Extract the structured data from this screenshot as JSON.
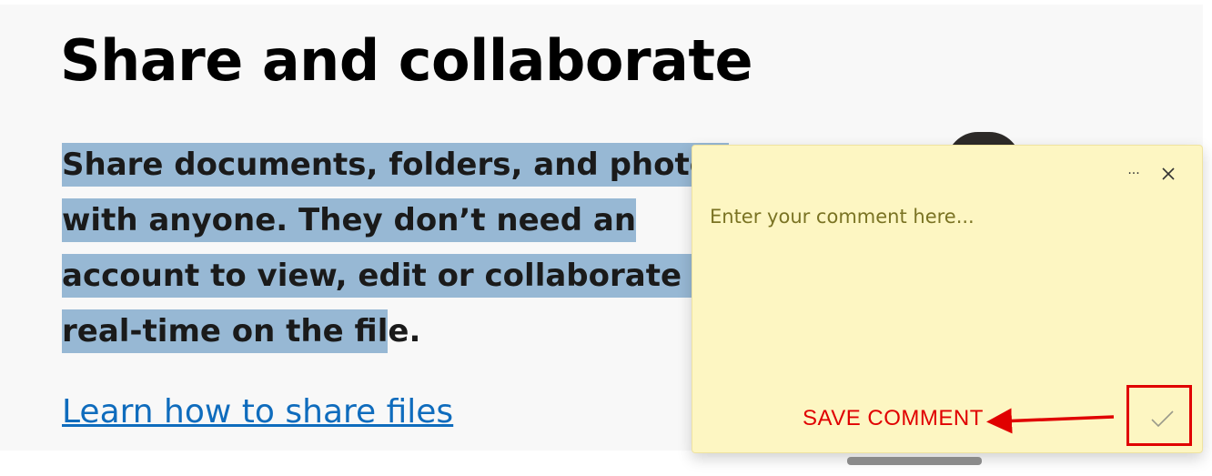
{
  "page": {
    "title": "Share and collaborate",
    "paragraph_lines": [
      "Share documents, folders, and photos",
      "with anyone. They don’t need an",
      "account to view, edit or collaborate in",
      "real-time on the fil"
    ],
    "paragraph_tail": "e.",
    "link_text": "Learn how to share files"
  },
  "comment_panel": {
    "more_icon": "ellipsis-icon",
    "more_label": "···",
    "close_icon": "close-icon",
    "placeholder": "Enter your comment here...",
    "value": "",
    "confirm_icon": "checkmark-icon"
  },
  "annotation": {
    "label": "SAVE COMMENT",
    "color": "#e00000"
  },
  "colors": {
    "highlight": "#97b8d4",
    "note_background": "#fdf6c2",
    "link": "#0f6cbd"
  }
}
